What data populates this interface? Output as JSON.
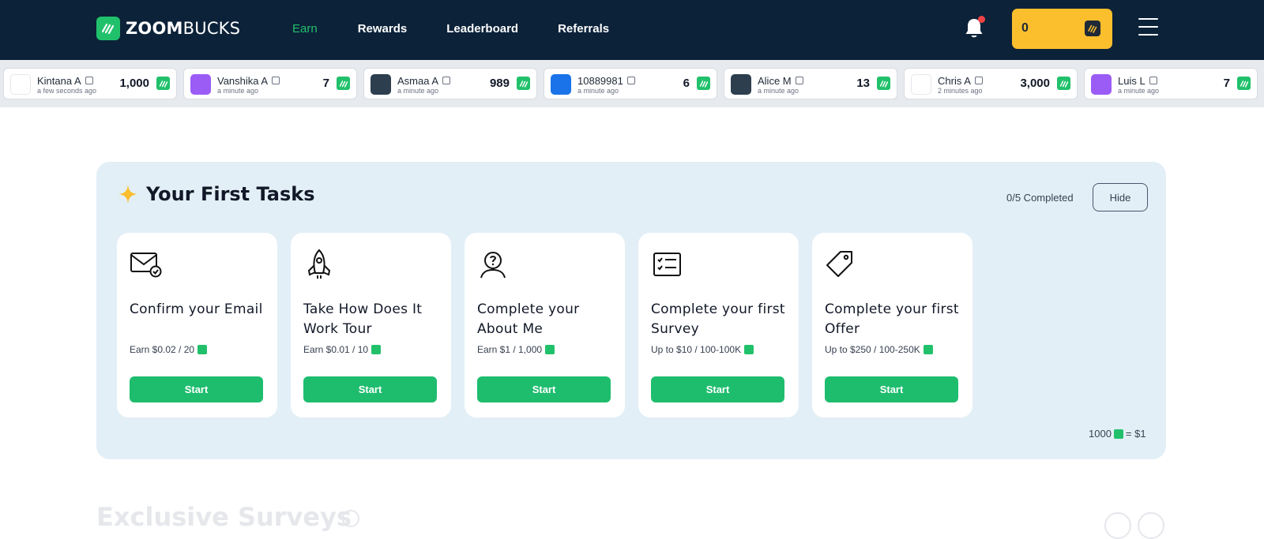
{
  "brand": {
    "name_bold": "ZOOM",
    "name_regular": "BUCKS",
    "accent": "#21c16b",
    "nav_bg": "#0c2239"
  },
  "nav": {
    "items": [
      {
        "label": "Earn",
        "active": true
      },
      {
        "label": "Rewards",
        "active": false
      },
      {
        "label": "Leaderboard",
        "active": false
      },
      {
        "label": "Referrals",
        "active": false
      }
    ]
  },
  "header": {
    "notification_icon": "bell-icon",
    "has_unread": true,
    "balance": "0",
    "balance_bg": "#fbbf2d",
    "menu_icon": "hamburger-icon"
  },
  "ticker": [
    {
      "name": "Kintana A",
      "time": "a few seconds ago",
      "amount": "1,000",
      "avatar_color": "#ffffff"
    },
    {
      "name": "Vanshika A",
      "time": "a minute ago",
      "amount": "7",
      "avatar_color": "#9b5cf6"
    },
    {
      "name": "Asmaa A",
      "time": "a minute ago",
      "amount": "989",
      "avatar_color": "#2d3e4e"
    },
    {
      "name": "10889981",
      "time": "a minute ago",
      "amount": "6",
      "avatar_color": "#1a73e8"
    },
    {
      "name": "Alice M",
      "time": "a minute ago",
      "amount": "13",
      "avatar_color": "#2d3e4e"
    },
    {
      "name": "Chris A",
      "time": "2 minutes ago",
      "amount": "3,000",
      "avatar_color": "#ffffff"
    },
    {
      "name": "Luis L",
      "time": "a minute ago",
      "amount": "7",
      "avatar_color": "#9b5cf6"
    }
  ],
  "tasks_panel": {
    "title": "Your First Tasks",
    "progress": "0/5 Completed",
    "hide_label": "Hide",
    "rate_left": "1000",
    "rate_right": "= $1",
    "tasks": [
      {
        "icon": "envelope-check-icon",
        "title": "Confirm your Email",
        "reward": "Earn $0.02 / 20",
        "button": "Start"
      },
      {
        "icon": "rocket-icon",
        "title": "Take How Does It Work Tour",
        "reward": "Earn $0.01 / 10",
        "button": "Start"
      },
      {
        "icon": "user-question-icon",
        "title": "Complete your About Me",
        "reward": "Earn $1 / 1,000",
        "button": "Start"
      },
      {
        "icon": "checklist-icon",
        "title": "Complete your first Survey",
        "reward": "Up to $10 / 100-100K",
        "button": "Start"
      },
      {
        "icon": "tag-icon",
        "title": "Complete your first Offer",
        "reward": "Up to $250 / 100-250K",
        "button": "Start"
      }
    ]
  },
  "exclusive": {
    "title": "Exclusive Surveys"
  }
}
